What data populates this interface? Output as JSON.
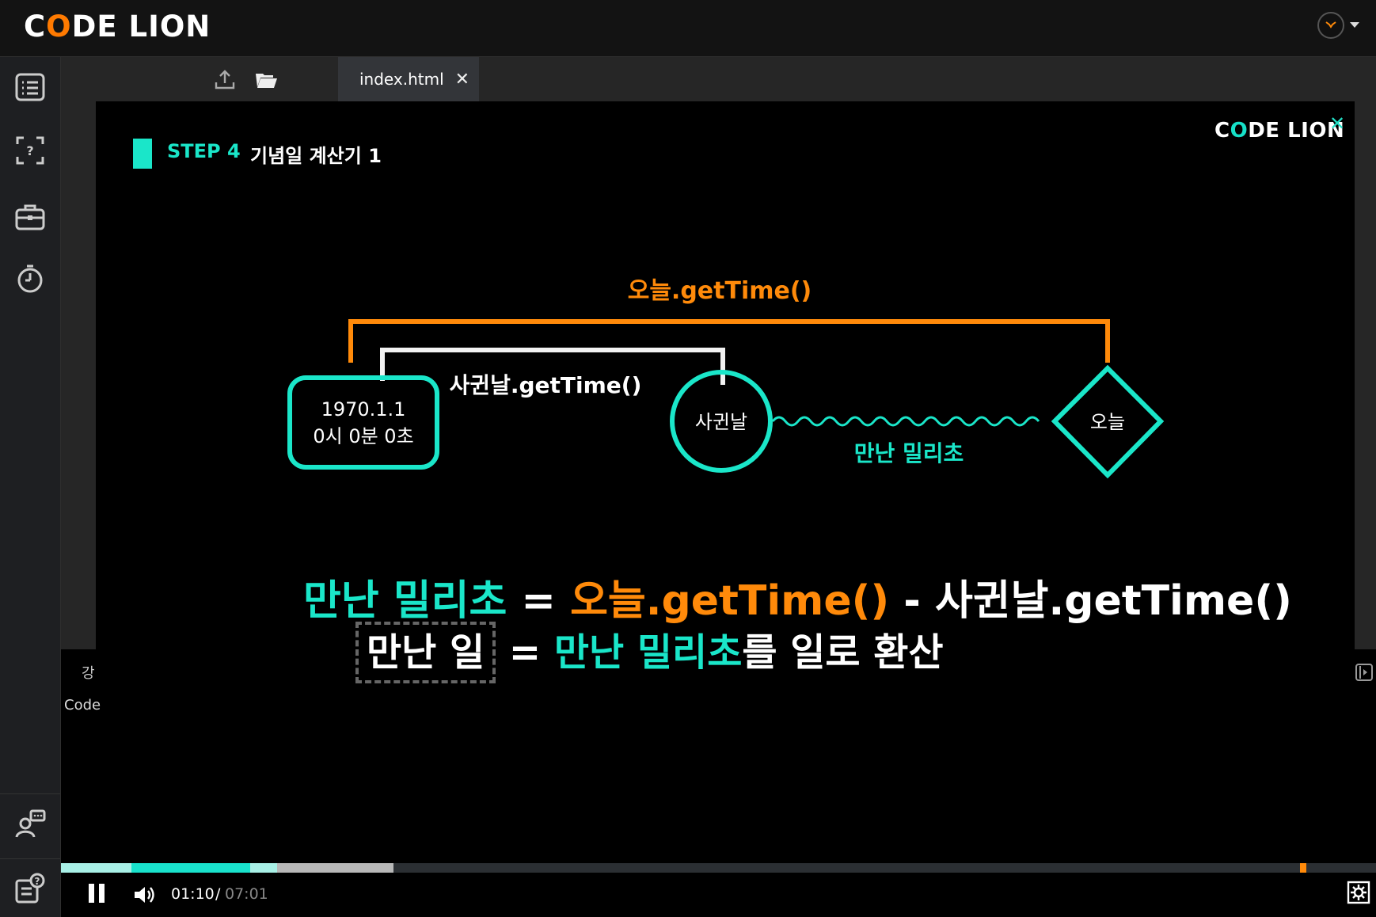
{
  "header": {
    "logo_text_pre": "C",
    "logo_text_o": "O",
    "logo_text_post": "DE LION",
    "avatar_icon": "lion-avatar-icon"
  },
  "sidebar": {
    "items": [
      {
        "name": "lecture-list-icon"
      },
      {
        "name": "question-icon"
      },
      {
        "name": "toolbox-icon"
      },
      {
        "name": "timer-icon"
      },
      {
        "name": "community-chat-icon"
      },
      {
        "name": "help-notes-icon"
      }
    ]
  },
  "editor": {
    "tab": {
      "label": "index.html",
      "close": "✕"
    },
    "lower_tab_label": "강",
    "lower_code_label": "Code"
  },
  "video": {
    "logo_pre": "C",
    "logo_o": "O",
    "logo_post": "DE LION",
    "close": "✕",
    "step_label": "STEP 4",
    "step_title": "기념일 계산기 1",
    "diagram": {
      "top_label": "오늘.getTime()",
      "mid_label": "사귄날.getTime()",
      "epoch_line1": "1970.1.1",
      "epoch_line2": "0시 0분 0초",
      "circle_label": "사귄날",
      "diamond_label": "오늘",
      "wave_label": "만난 밀리초"
    },
    "equation1": {
      "part1": "만난 밀리초",
      "op1": " = ",
      "part2": "오늘.getTime()",
      "op2": " - ",
      "part3": "사귄날.getTime()"
    },
    "equation2": {
      "boxed": "만난 일",
      "op": " = ",
      "teal": "만난 밀리초",
      "rest": "를 일로 환산"
    }
  },
  "player": {
    "current_time": "01:10",
    "separator": "/",
    "total_time": "07:01",
    "played_fraction": 0.166,
    "buffered_fraction": 0.228,
    "colors": {
      "played": "#19e2cc",
      "played_light": "#a8f0e6",
      "buffered": "#b8b8b8",
      "marker": "#ff8a0a"
    }
  },
  "colors": {
    "accent_teal": "#1ae6c9",
    "accent_orange": "#ff8a0a"
  }
}
